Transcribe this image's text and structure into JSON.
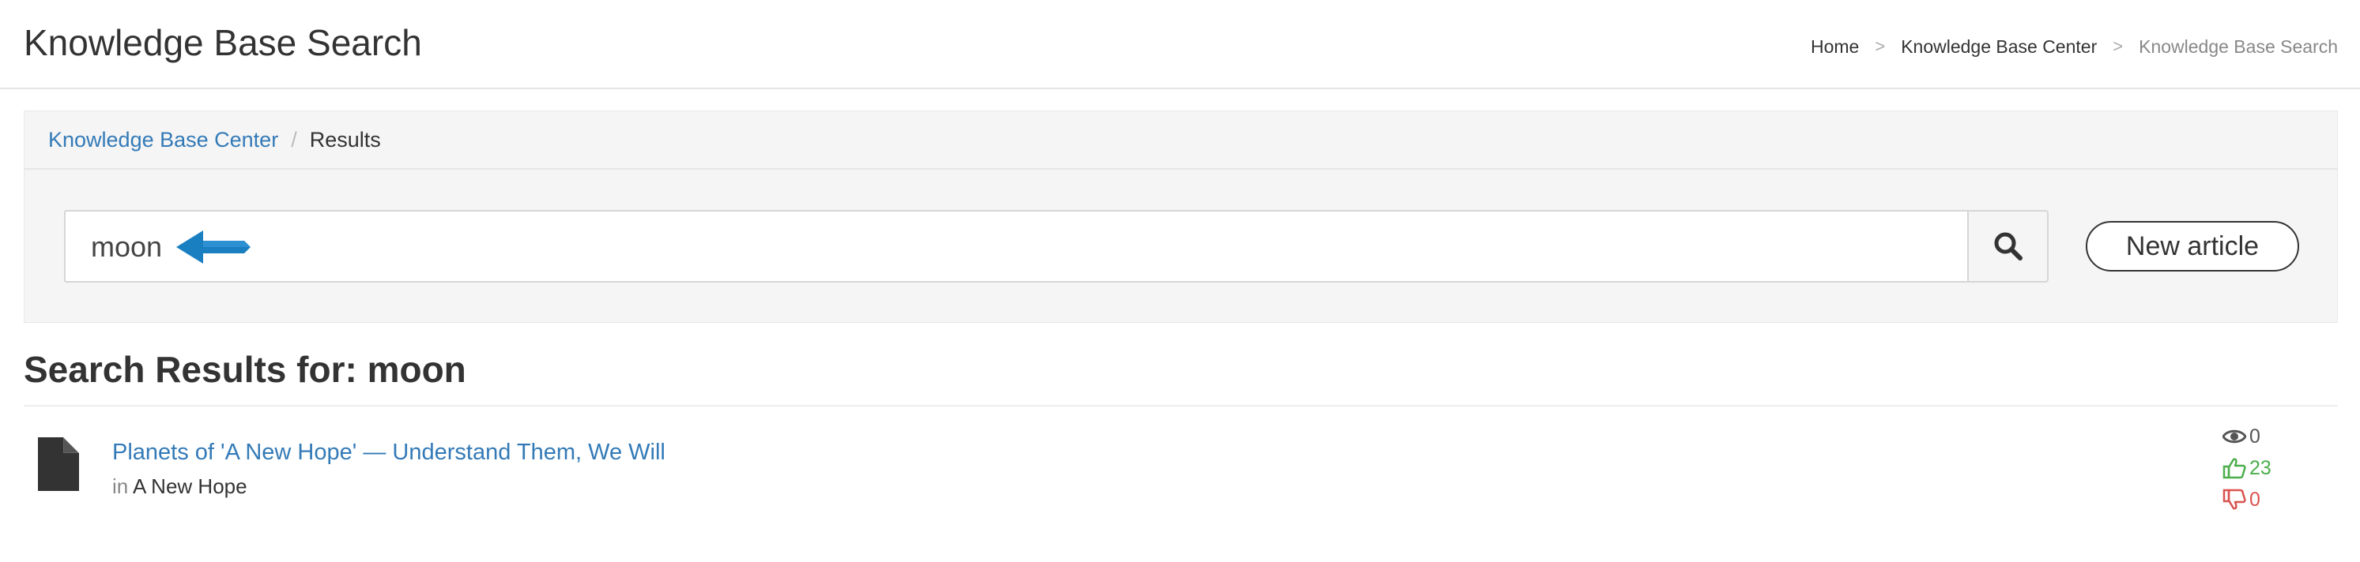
{
  "header": {
    "title": "Knowledge Base Search",
    "breadcrumb": [
      {
        "label": "Home"
      },
      {
        "label": "Knowledge Base Center"
      },
      {
        "label": "Knowledge Base Search"
      }
    ],
    "separator": ">"
  },
  "panel": {
    "breadcrumb": {
      "link": "Knowledge Base Center",
      "separator": "/",
      "current": "Results"
    },
    "search": {
      "value": "moon",
      "button_icon": "search-icon"
    },
    "new_article_label": "New article"
  },
  "results": {
    "heading": "Search Results for: moon",
    "items": [
      {
        "icon": "document-icon",
        "title": "Planets of 'A New Hope' — Understand Them, We Will",
        "in_label": "in",
        "category": "A New Hope",
        "views": "0",
        "likes": "23",
        "dislikes": "0"
      }
    ]
  },
  "colors": {
    "link": "#337ab7",
    "like": "#4cae4c",
    "dislike": "#d9534f",
    "arrow": "#1a7fc1"
  }
}
